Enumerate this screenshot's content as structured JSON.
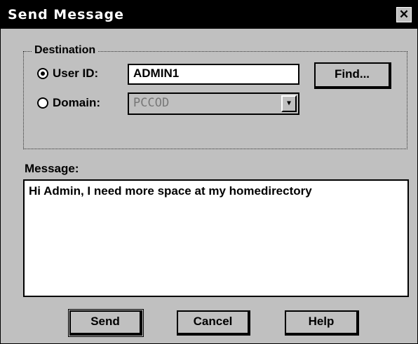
{
  "window": {
    "title": "Send Message",
    "close_glyph": "✕"
  },
  "destination": {
    "group_label": "Destination",
    "user_id": {
      "label": "User ID:",
      "value": "ADMIN1",
      "selected": true
    },
    "domain": {
      "label": "Domain:",
      "value": "PCCOD",
      "selected": false,
      "enabled": false
    },
    "find_button": "Find..."
  },
  "message": {
    "label": "Message:",
    "text": "Hi Admin, I need more space at my homedirectory"
  },
  "buttons": {
    "send": "Send",
    "cancel": "Cancel",
    "help": "Help"
  },
  "colors": {
    "title_bar": "#000000",
    "title_text": "#ffffff",
    "dialog_face": "#d4d4d4",
    "disabled_text": "#777777"
  },
  "icons": {
    "close": "close-icon",
    "dropdown": "chevron-down-icon"
  }
}
